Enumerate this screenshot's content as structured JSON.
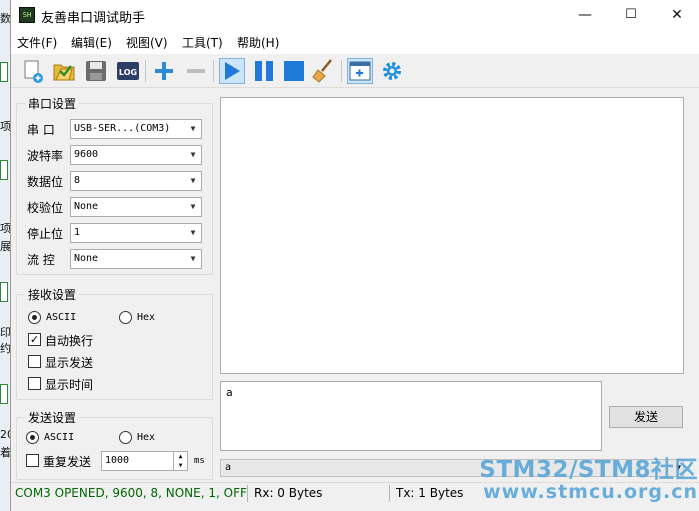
{
  "window": {
    "title": "友善串口调试助手",
    "app_icon_text": "SH",
    "minimize": "—",
    "maximize": "☐",
    "close": "✕"
  },
  "menu": [
    "文件(F)",
    "编辑(E)",
    "视图(V)",
    "工具(T)",
    "帮助(H)"
  ],
  "toolbar": {
    "icons": [
      "new-file-icon",
      "open-folder-icon",
      "save-icon",
      "log-icon",
      "add-icon",
      "remove-icon",
      "play-icon",
      "pause-icon",
      "stop-icon",
      "clear-broom-icon",
      "add-window-icon",
      "settings-gear-icon"
    ],
    "log_label": "LOG"
  },
  "serial_settings": {
    "title": "串口设置",
    "rows": [
      {
        "label": "串  口",
        "value": "USB-SER...(COM3)"
      },
      {
        "label": "波特率",
        "value": "9600"
      },
      {
        "label": "数据位",
        "value": "8"
      },
      {
        "label": "校验位",
        "value": "None"
      },
      {
        "label": "停止位",
        "value": "1"
      },
      {
        "label": "流  控",
        "value": "None"
      }
    ]
  },
  "receive_settings": {
    "title": "接收设置",
    "ascii": "ASCII",
    "hex": "Hex",
    "ascii_selected": true,
    "auto_wrap": "自动换行",
    "auto_wrap_checked": true,
    "show_send": "显示发送",
    "show_send_checked": false,
    "show_time": "显示时间",
    "show_time_checked": false
  },
  "send_settings": {
    "title": "发送设置",
    "ascii": "ASCII",
    "hex": "Hex",
    "ascii_selected": true,
    "repeat": "重复发送",
    "repeat_checked": false,
    "interval": "1000",
    "unit": "ms"
  },
  "send_box": {
    "text": "a"
  },
  "send_button": "发送",
  "history_value": "a",
  "status": {
    "connection": "COM3 OPENED, 9600, 8, NONE, 1, OFF",
    "rx": "Rx: 0 Bytes",
    "tx": "Tx: 1 Bytes"
  },
  "watermark": {
    "line1": "STM32/STM8社区",
    "line2": "www.stmcu.org.cn"
  },
  "desktop_fragments": [
    "数",
    "项",
    "项",
    "展",
    "印",
    "约",
    "20",
    "着"
  ],
  "colors": {
    "status_green": "#006600",
    "accent_blue": "#1e7ad6",
    "watermark": "#5ba7d9"
  }
}
